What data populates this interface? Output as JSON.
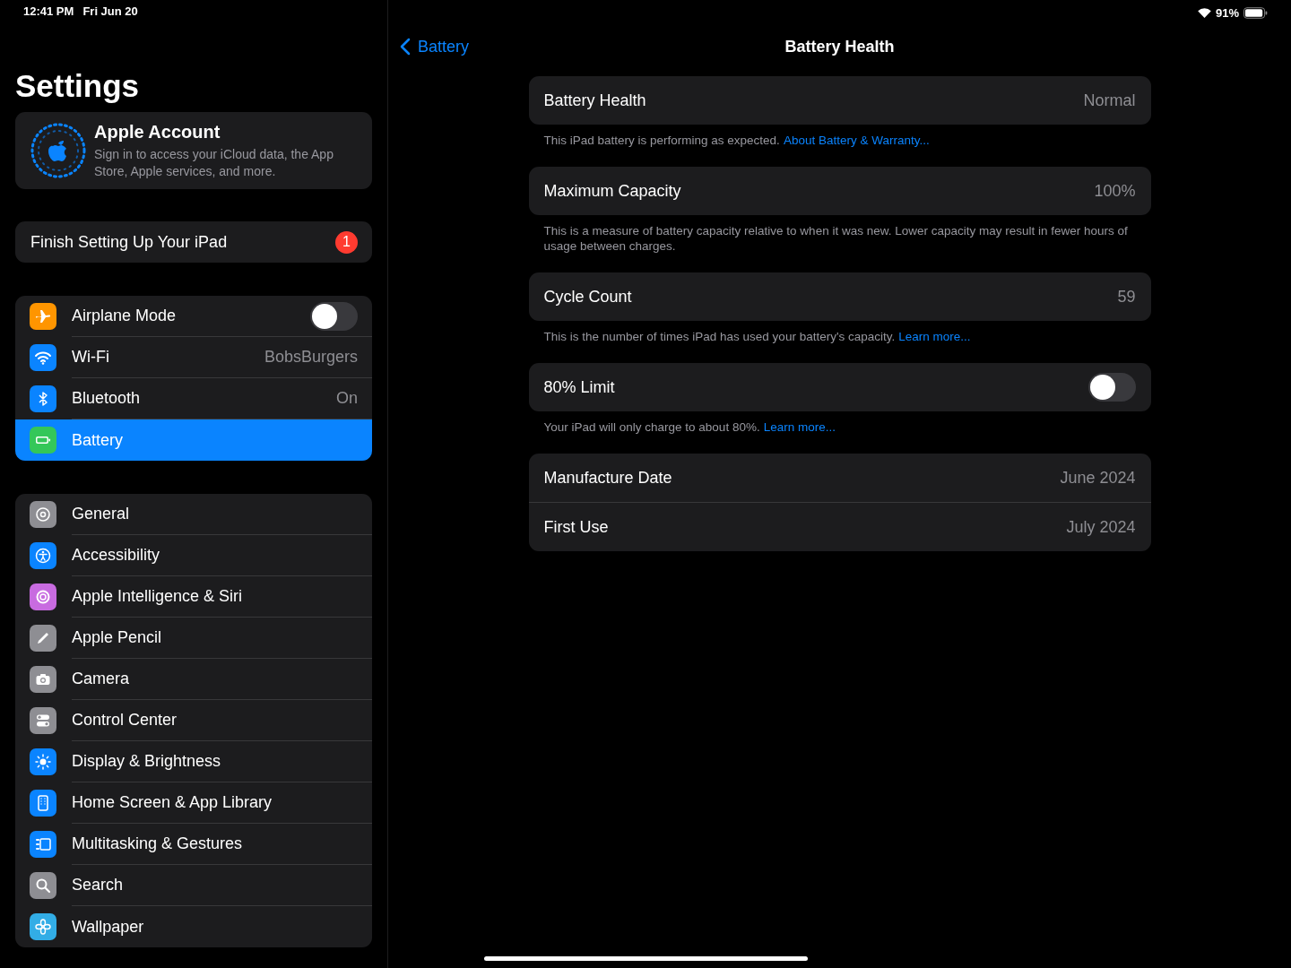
{
  "status_bar": {
    "time": "12:41 PM",
    "date": "Fri Jun 20",
    "battery": "91%"
  },
  "sidebar": {
    "title": "Settings",
    "account": {
      "name": "Apple Account",
      "description": "Sign in to access your iCloud data, the App Store, Apple services, and more."
    },
    "finish_setup": {
      "label": "Finish Setting Up Your iPad",
      "badge": "1"
    },
    "groups": [
      {
        "items": [
          {
            "label": "Airplane Mode",
            "kind": "toggle",
            "on": false,
            "selected": false,
            "color": "#ff9500"
          },
          {
            "label": "Wi-Fi",
            "kind": "value",
            "value": "BobsBurgers",
            "selected": false,
            "color": "#0a84ff"
          },
          {
            "label": "Bluetooth",
            "kind": "value",
            "value": "On",
            "selected": false,
            "color": "#0a84ff"
          },
          {
            "label": "Battery",
            "kind": "plain",
            "selected": true,
            "color": "#34c759"
          }
        ]
      },
      {
        "items": [
          {
            "label": "General",
            "kind": "plain",
            "selected": false,
            "color": "#8e8e93"
          },
          {
            "label": "Accessibility",
            "kind": "plain",
            "selected": false,
            "color": "#0a84ff"
          },
          {
            "label": "Apple Intelligence & Siri",
            "kind": "plain",
            "selected": false,
            "color": "#c86be0"
          },
          {
            "label": "Apple Pencil",
            "kind": "plain",
            "selected": false,
            "color": "#8e8e93"
          },
          {
            "label": "Camera",
            "kind": "plain",
            "selected": false,
            "color": "#8e8e93"
          },
          {
            "label": "Control Center",
            "kind": "plain",
            "selected": false,
            "color": "#8e8e93"
          },
          {
            "label": "Display & Brightness",
            "kind": "plain",
            "selected": false,
            "color": "#0a84ff"
          },
          {
            "label": "Home Screen & App Library",
            "kind": "plain",
            "selected": false,
            "color": "#0a84ff"
          },
          {
            "label": "Multitasking & Gestures",
            "kind": "plain",
            "selected": false,
            "color": "#0a84ff"
          },
          {
            "label": "Search",
            "kind": "plain",
            "selected": false,
            "color": "#8e8e93"
          },
          {
            "label": "Wallpaper",
            "kind": "plain",
            "selected": false,
            "color": "#32ade6"
          }
        ]
      }
    ]
  },
  "detail": {
    "back": "Battery",
    "title": "Battery Health",
    "sections": [
      {
        "rows": [
          {
            "label": "Battery Health",
            "kind": "value",
            "value": "Normal"
          }
        ],
        "note": "This iPad battery is performing as expected.",
        "link": "About Battery & Warranty..."
      },
      {
        "rows": [
          {
            "label": "Maximum Capacity",
            "kind": "value",
            "value": "100%"
          }
        ],
        "note": "This is a measure of battery capacity relative to when it was new. Lower capacity may result in fewer hours of usage between charges."
      },
      {
        "rows": [
          {
            "label": "Cycle Count",
            "kind": "value",
            "value": "59"
          }
        ],
        "note": "This is the number of times iPad has used your battery's capacity.",
        "link": "Learn more..."
      },
      {
        "rows": [
          {
            "label": "80% Limit",
            "kind": "toggle",
            "on": false
          }
        ],
        "note": "Your iPad will only charge to about 80%.",
        "link": "Learn more..."
      },
      {
        "rows": [
          {
            "label": "Manufacture Date",
            "kind": "value",
            "value": "June 2024"
          },
          {
            "label": "First Use",
            "kind": "value",
            "value": "July 2024"
          }
        ]
      }
    ]
  }
}
